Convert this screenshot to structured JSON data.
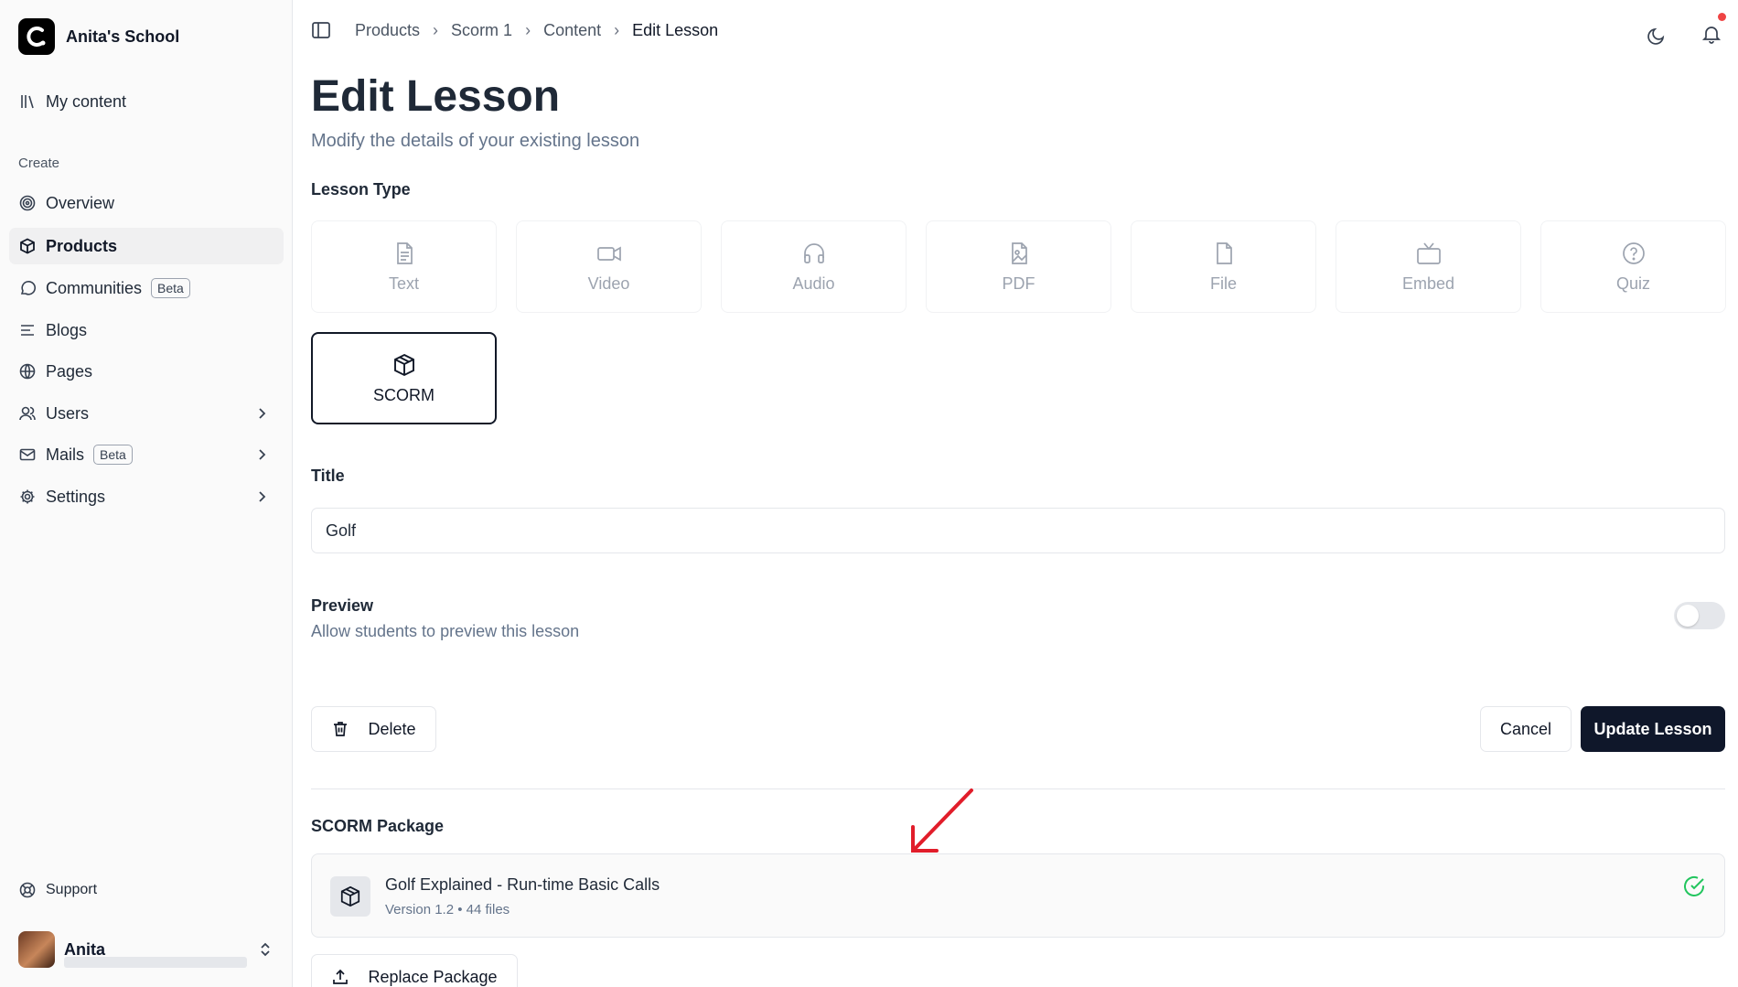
{
  "sidebar": {
    "brand": "Anita's School",
    "my_content": "My content",
    "section_create": "Create",
    "items": [
      {
        "label": "Overview",
        "icon": "target-icon"
      },
      {
        "label": "Products",
        "icon": "box-icon"
      },
      {
        "label": "Communities",
        "icon": "chat-icon",
        "badge": "Beta"
      },
      {
        "label": "Blogs",
        "icon": "list-icon"
      },
      {
        "label": "Pages",
        "icon": "globe-icon"
      },
      {
        "label": "Users",
        "icon": "users-icon"
      },
      {
        "label": "Mails",
        "icon": "mail-icon",
        "badge": "Beta"
      },
      {
        "label": "Settings",
        "icon": "gear-icon"
      }
    ],
    "support": "Support",
    "user": {
      "name": "Anita"
    }
  },
  "breadcrumb": [
    "Products",
    "Scorm 1",
    "Content",
    "Edit Lesson"
  ],
  "page": {
    "title": "Edit Lesson",
    "subtitle": "Modify the details of your existing lesson"
  },
  "lesson_type": {
    "label": "Lesson Type",
    "types": [
      "Text",
      "Video",
      "Audio",
      "PDF",
      "File",
      "Embed",
      "Quiz"
    ],
    "selected": "SCORM"
  },
  "title_field": {
    "label": "Title",
    "value": "Golf"
  },
  "preview": {
    "label": "Preview",
    "description": "Allow students to preview this lesson",
    "enabled": false
  },
  "actions": {
    "delete": "Delete",
    "cancel": "Cancel",
    "update": "Update Lesson"
  },
  "scorm": {
    "label": "SCORM Package",
    "package_name": "Golf Explained - Run-time Basic Calls",
    "package_meta": "Version 1.2 • 44 files",
    "replace": "Replace Package"
  },
  "colors": {
    "primary": "#0f172a",
    "success": "#22c55e",
    "annotation": "#e11d2a",
    "notification_dot": "#ef4444"
  }
}
